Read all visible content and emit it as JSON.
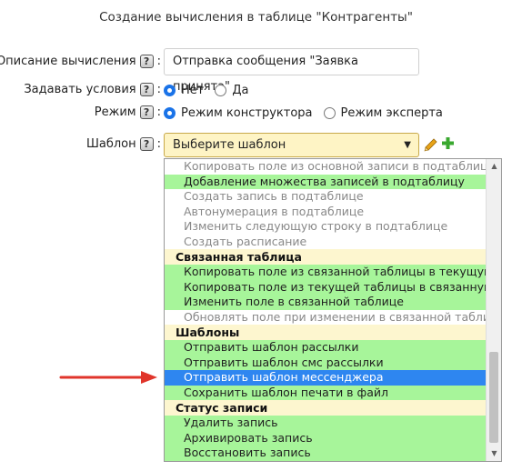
{
  "dialog": {
    "title": "Создание вычисления в таблице \"Контрагенты\""
  },
  "form": {
    "description_label": "Описание вычисления",
    "description_value": "Отправка сообщения \"Заявка принята\"",
    "conditions_label": "Задавать условия",
    "conditions_options": [
      "Нет",
      "Да"
    ],
    "conditions_selected": "Нет",
    "mode_label": "Режим",
    "mode_options": [
      "Режим конструктора",
      "Режим эксперта"
    ],
    "mode_selected": "Режим конструктора",
    "template_label": "Шаблон",
    "template_placeholder": "Выберите шаблон",
    "help_glyph": "?",
    "colon": ":"
  },
  "dropdown": {
    "items": [
      {
        "type": "option",
        "label": "Копировать поле из основной записи в подтаблицу",
        "state": "gray"
      },
      {
        "type": "option",
        "label": "Добавление множества записей в подтаблицу",
        "state": "green"
      },
      {
        "type": "option",
        "label": "Создать запись в подтаблице",
        "state": "gray"
      },
      {
        "type": "option",
        "label": "Автонумерация в подтаблице",
        "state": "gray"
      },
      {
        "type": "option",
        "label": "Изменить следующую строку в подтаблице",
        "state": "gray"
      },
      {
        "type": "option",
        "label": "Создать расписание",
        "state": "gray"
      },
      {
        "type": "group",
        "label": "Связанная таблица"
      },
      {
        "type": "option",
        "label": "Копировать поле из связанной таблицы в текущую",
        "state": "green"
      },
      {
        "type": "option",
        "label": "Копировать поле из текущей таблицы в связанную",
        "state": "green"
      },
      {
        "type": "option",
        "label": "Изменить поле в связанной таблице",
        "state": "green"
      },
      {
        "type": "option",
        "label": "Обновлять поле при изменении в связанной таблице",
        "state": "gray"
      },
      {
        "type": "group",
        "label": "Шаблоны"
      },
      {
        "type": "option",
        "label": "Отправить шаблон рассылки",
        "state": "green"
      },
      {
        "type": "option",
        "label": "Отправить шаблон смс рассылки",
        "state": "green"
      },
      {
        "type": "option",
        "label": "Отправить шаблон мессенджера",
        "state": "selected"
      },
      {
        "type": "option",
        "label": "Сохранить шаблон печати в файл",
        "state": "green"
      },
      {
        "type": "group",
        "label": "Статус записи"
      },
      {
        "type": "option",
        "label": "Удалить запись",
        "state": "green"
      },
      {
        "type": "option",
        "label": "Архивировать запись",
        "state": "green"
      },
      {
        "type": "option",
        "label": "Восстановить запись",
        "state": "green"
      }
    ]
  },
  "colors": {
    "green_option": "#a7f59a",
    "selected_option": "#2e86f0",
    "group_header": "#fdf6cf",
    "select_bg": "#fef4c5",
    "annotation_arrow": "#e0352b",
    "plus_icon": "#3aa82f",
    "pencil_icon": "#e8a317"
  },
  "icons": [
    "help-icon",
    "pencil-icon",
    "plus-icon",
    "chevron-down-icon",
    "scroll-up-icon",
    "scroll-down-icon",
    "red-arrow-annotation"
  ]
}
